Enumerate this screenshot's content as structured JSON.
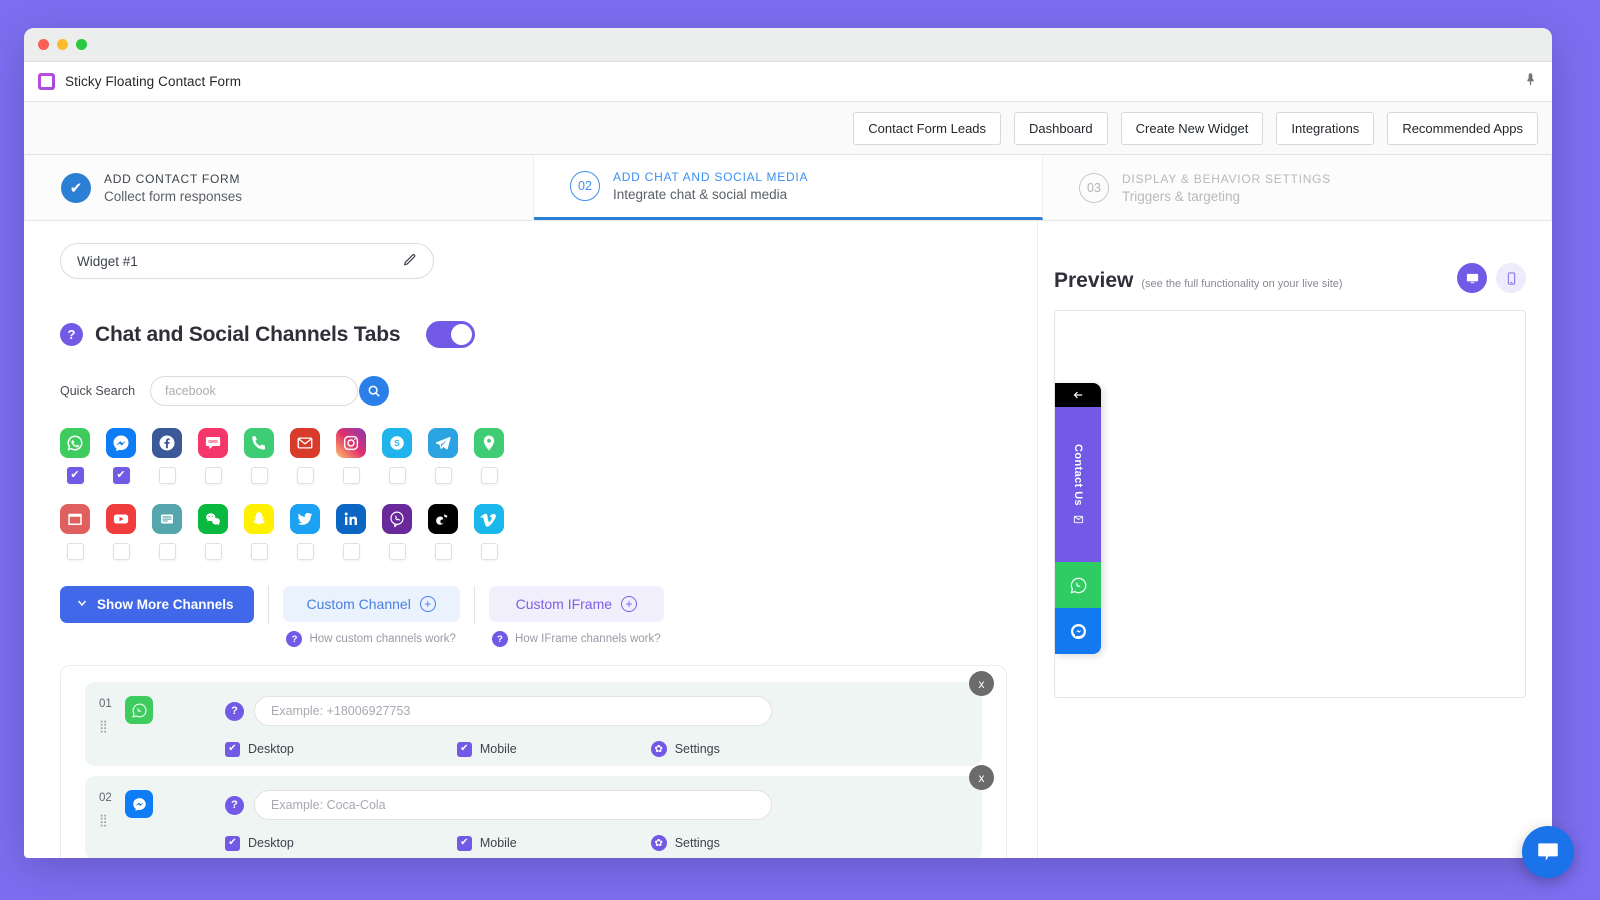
{
  "window": {
    "plugin_title": "Sticky Floating Contact Form",
    "plugin_icon": "window-icon",
    "pin_icon": "pin-icon"
  },
  "nav": {
    "buttons": [
      {
        "label": "Contact Form Leads"
      },
      {
        "label": "Dashboard"
      },
      {
        "label": "Create New Widget"
      },
      {
        "label": "Integrations"
      },
      {
        "label": "Recommended Apps"
      }
    ]
  },
  "steps": [
    {
      "num": "✔",
      "title": "ADD CONTACT FORM",
      "sub": "Collect form responses",
      "state": "done"
    },
    {
      "num": "02",
      "title": "ADD CHAT AND SOCIAL MEDIA",
      "sub": "Integrate chat & social media",
      "state": "active"
    },
    {
      "num": "03",
      "title": "DISPLAY & BEHAVIOR SETTINGS",
      "sub": "Triggers & targeting",
      "state": "todo"
    }
  ],
  "widget": {
    "name_value": "Widget #1",
    "edit_icon": "pencil-icon"
  },
  "section": {
    "help_badge": "?",
    "title": "Chat and Social Channels Tabs",
    "toggle_on": "true"
  },
  "quick_search": {
    "label": "Quick Search",
    "value": "facebook",
    "search_icon": "search-icon"
  },
  "channels": {
    "row1": [
      {
        "name": "whatsapp",
        "label": "WhatsApp",
        "color": "#3ecc5f",
        "checked": true
      },
      {
        "name": "messenger",
        "label": "Messenger",
        "color": "#0e7cf4",
        "checked": true
      },
      {
        "name": "facebook",
        "label": "Facebook",
        "color": "#3b5998",
        "checked": false
      },
      {
        "name": "sms",
        "label": "SMS",
        "color": "#f5366a",
        "checked": false
      },
      {
        "name": "phone",
        "label": "Phone",
        "color": "#3ecc74",
        "checked": false
      },
      {
        "name": "email",
        "label": "Email",
        "color": "#d93b2b",
        "checked": false
      },
      {
        "name": "instagram",
        "label": "Instagram",
        "color": "#e1306c",
        "checked": false
      },
      {
        "name": "skype",
        "label": "Skype",
        "color": "#21b4ec",
        "checked": false
      },
      {
        "name": "telegram",
        "label": "Telegram",
        "color": "#2aa3e0",
        "checked": false
      },
      {
        "name": "location",
        "label": "Location",
        "color": "#3ecc74",
        "checked": false
      }
    ],
    "row2": [
      {
        "name": "calendar",
        "label": "Calendar",
        "color": "#e06060",
        "checked": false
      },
      {
        "name": "youtube",
        "label": "YouTube",
        "color": "#f03c3c",
        "checked": false
      },
      {
        "name": "form",
        "label": "Form",
        "color": "#55a5ad",
        "checked": false
      },
      {
        "name": "wechat",
        "label": "WeChat",
        "color": "#09b83e",
        "checked": false
      },
      {
        "name": "snapchat",
        "label": "Snapchat",
        "color": "#fff000",
        "checked": false
      },
      {
        "name": "twitter",
        "label": "Twitter",
        "color": "#1da1f2",
        "checked": false
      },
      {
        "name": "linkedin",
        "label": "LinkedIn",
        "color": "#0a66c2",
        "checked": false
      },
      {
        "name": "viber",
        "label": "Viber",
        "color": "#69299b",
        "checked": false
      },
      {
        "name": "tiktok",
        "label": "TikTok",
        "color": "#000000",
        "checked": false
      },
      {
        "name": "vimeo",
        "label": "Vimeo",
        "color": "#1ab7ea",
        "checked": false
      }
    ]
  },
  "actions": {
    "show_more_label": "Show More Channels",
    "show_more_icon": "chevron-down-icon",
    "custom_channel_label": "Custom Channel",
    "custom_iframe_label": "Custom IFrame",
    "plus_icon": "plus-icon",
    "help_custom": "How custom channels work?",
    "help_iframe": "How IFrame channels work?",
    "help_badge": "?"
  },
  "configured": [
    {
      "num": "01",
      "channel": "whatsapp",
      "color": "#3ecc5f",
      "placeholder": "Example: +18006927753",
      "desktop_label": "Desktop",
      "desktop_checked": true,
      "mobile_label": "Mobile",
      "mobile_checked": true,
      "settings_label": "Settings",
      "close_label": "x",
      "help_badge": "?"
    },
    {
      "num": "02",
      "channel": "messenger",
      "color": "#0e7cf4",
      "placeholder": "Example: Coca-Cola",
      "desktop_label": "Desktop",
      "desktop_checked": true,
      "mobile_label": "Mobile",
      "mobile_checked": true,
      "settings_label": "Settings",
      "close_label": "x",
      "help_badge": "?"
    }
  ],
  "preview": {
    "title": "Preview",
    "subtitle": "(see the full functionality on your live site)",
    "desktop_icon": "monitor-icon",
    "mobile_icon": "phone-icon",
    "widget": {
      "back_icon": "arrow-left-icon",
      "label": "Contact Us",
      "label_icon": "envelope-icon",
      "tabs": [
        {
          "name": "whatsapp",
          "color": "#2ecc62"
        },
        {
          "name": "messenger",
          "color": "#1279f0"
        }
      ]
    }
  },
  "chat_bubble": {
    "icon": "chat-icon",
    "color": "#1a73e8"
  },
  "colors": {
    "page_background": "#7c6ef0",
    "accent_purple": "#7259e6",
    "accent_blue": "#2b7fd4",
    "button_blue": "#4168e8"
  }
}
